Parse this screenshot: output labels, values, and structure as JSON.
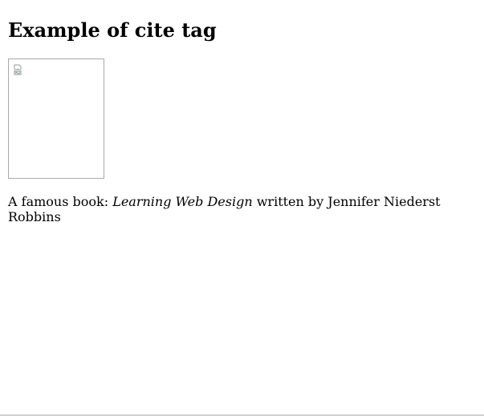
{
  "page": {
    "heading": "Example of cite tag",
    "image": {
      "icon": "broken-image-icon"
    },
    "caption": {
      "prefix": "A famous book: ",
      "book_title": "Learning Web Design",
      "suffix": " written by Jennifer Niederst Robbins"
    }
  }
}
